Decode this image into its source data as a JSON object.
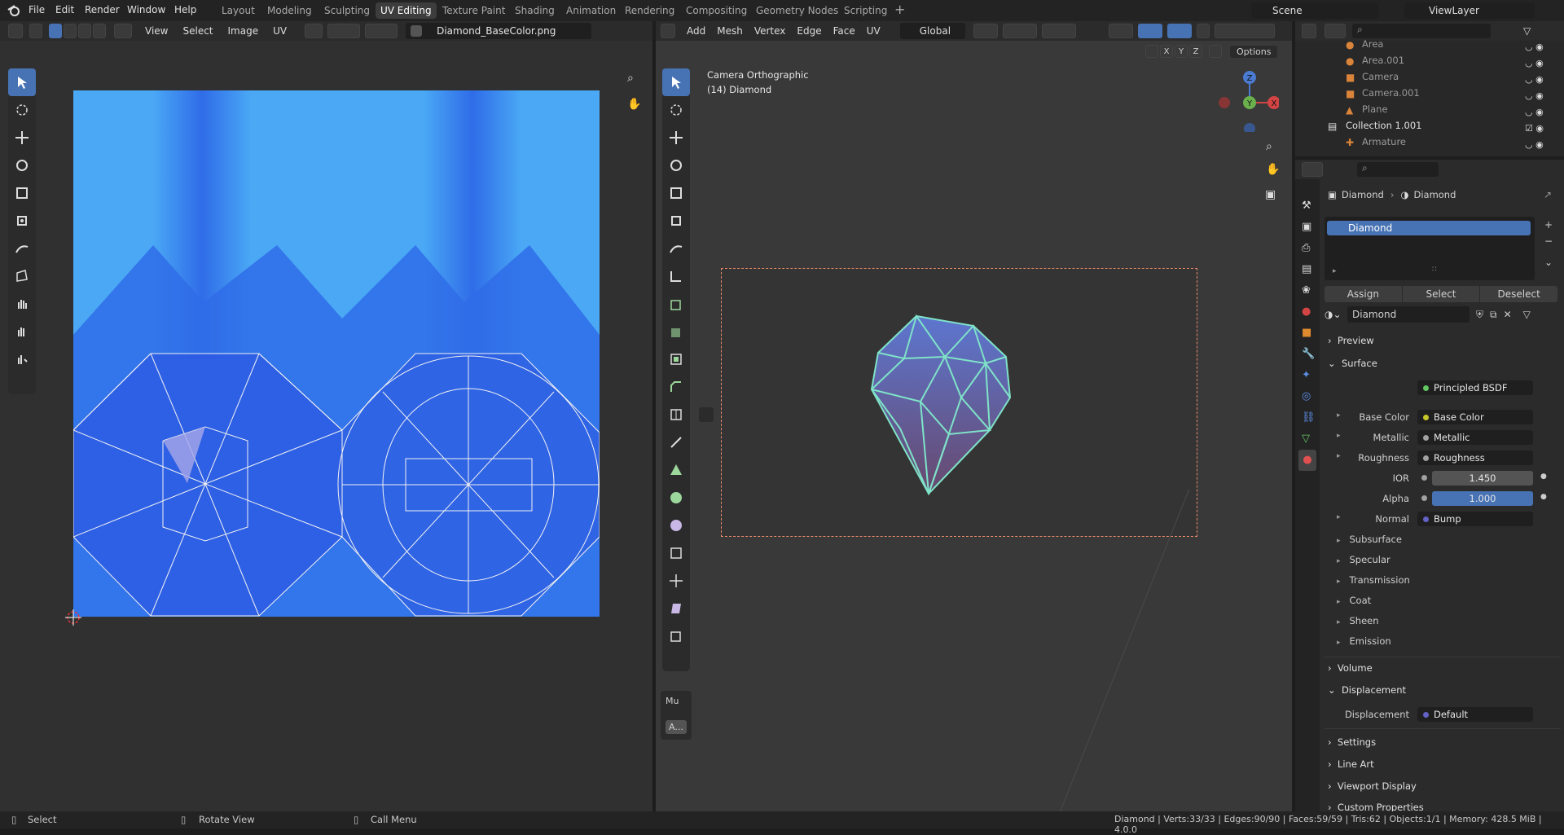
{
  "menus": [
    "File",
    "Edit",
    "Render",
    "Window",
    "Help"
  ],
  "workspaces": [
    "Layout",
    "Modeling",
    "Sculpting",
    "UV Editing",
    "Texture Paint",
    "Shading",
    "Animation",
    "Rendering",
    "Compositing",
    "Geometry Nodes",
    "Scripting"
  ],
  "active_workspace": "UV Editing",
  "scene": "Scene",
  "view_layer": "ViewLayer",
  "uv_header": {
    "menus": [
      "View",
      "Select",
      "Image",
      "UV"
    ],
    "image_name": "Diamond_BaseColor.png"
  },
  "vp_header": {
    "menus": [
      "Add",
      "Mesh",
      "Vertex",
      "Edge",
      "Face",
      "UV"
    ],
    "orientation": "Global",
    "axes": [
      "X",
      "Y",
      "Z"
    ],
    "options": "Options"
  },
  "viewport": {
    "camera": "Camera Orthographic",
    "object": "(14) Diamond",
    "gizmo": {
      "z": "Z",
      "y": "Y",
      "x": "X"
    },
    "redo_panel": "Mu",
    "redo_btn": "A..."
  },
  "outliner": {
    "items": [
      "Area",
      "Area.001",
      "Camera",
      "Camera.001",
      "Plane",
      "Collection 1.001",
      "Armature"
    ]
  },
  "props": {
    "breadcrumb": [
      "Diamond",
      "Diamond"
    ],
    "material_slot": "Diamond",
    "btn_assign": "Assign",
    "btn_select": "Select",
    "btn_deselect": "Deselect",
    "material_name": "Diamond",
    "sections": {
      "preview": "Preview",
      "surface": "Surface",
      "volume": "Volume",
      "displacement": "Displacement",
      "settings": "Settings",
      "line_art": "Line Art",
      "viewport_display": "Viewport Display",
      "custom_properties": "Custom Properties"
    },
    "surface_rows": [
      {
        "label": "Surface",
        "value": "Principled BSDF",
        "color": "#63c763"
      },
      {
        "label": "Base Color",
        "value": "Base Color",
        "color": "#c7c729"
      },
      {
        "label": "Metallic",
        "value": "Metallic",
        "color": "#a1a1a1"
      },
      {
        "label": "Roughness",
        "value": "Roughness",
        "color": "#a1a1a1"
      },
      {
        "label": "IOR",
        "value": "1.450",
        "color": "#a1a1a1"
      },
      {
        "label": "Alpha",
        "value": "1.000",
        "color": "#a1a1a1"
      },
      {
        "label": "Normal",
        "value": "Bump",
        "color": "#6363c7"
      }
    ],
    "subpanels": [
      "Subsurface",
      "Specular",
      "Transmission",
      "Coat",
      "Sheen",
      "Emission"
    ],
    "displacement_label": "Displacement",
    "displacement_value": "Default"
  },
  "status": {
    "select": "Select",
    "rotate": "Rotate View",
    "call_menu": "Call Menu",
    "info": "Diamond | Verts:33/33 | Edges:90/90 | Faces:59/59 | Tris:62 | Objects:1/1 | Memory: 428.5 MiB | 4.0.0"
  },
  "colors": {
    "accent": "#4772b3",
    "wire": "#7fe3c8",
    "uv_bg": "#4aa8f5",
    "uv_dark": "#2a4fe0"
  }
}
